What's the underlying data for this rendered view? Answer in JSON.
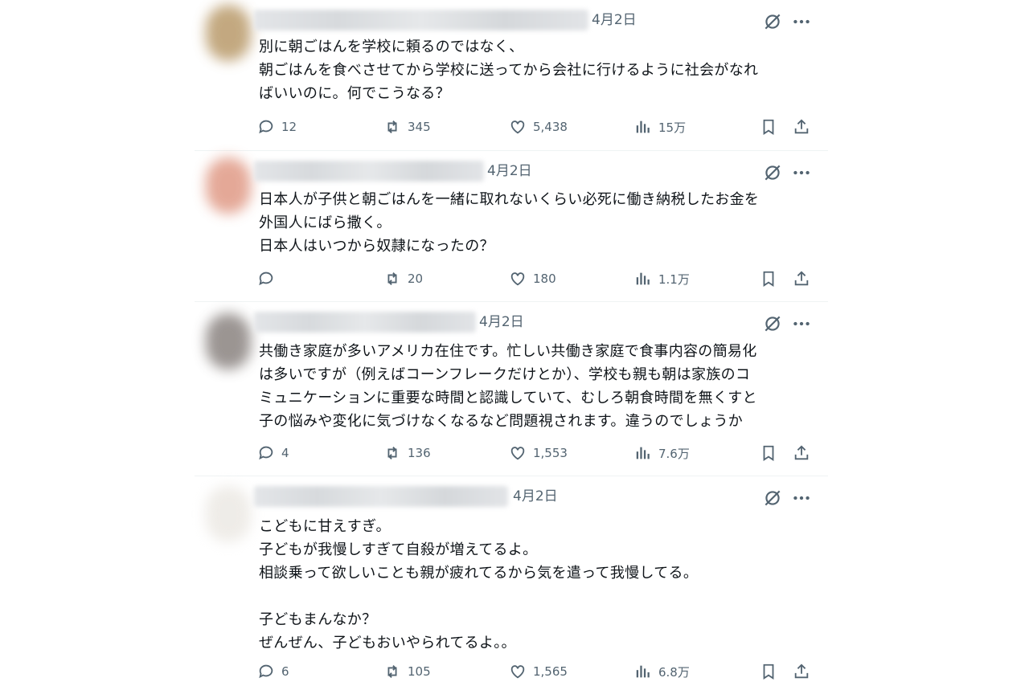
{
  "posts": [
    {
      "date": "4月2日",
      "text": "別に朝ごはんを学校に頼るのではなく、\n朝ごはんを食べさせてから学校に送ってから会社に行けるように社会がなれ\nばいいのに。何でこうなる？",
      "replies": "12",
      "reposts": "345",
      "likes": "5,438",
      "views": "15万"
    },
    {
      "date": "4月2日",
      "text": "日本人が子供と朝ごはんを一緒に取れないくらい必死に働き納税したお金を\n外国人にばら撒く。\n日本人はいつから奴隷になったの？",
      "replies": "",
      "reposts": "20",
      "likes": "180",
      "views": "1.1万"
    },
    {
      "date": "4月2日",
      "text": "共働き家庭が多いアメリカ在住です。忙しい共働き家庭で食事内容の簡易化\nは多いですが（例えばコーンフレークだけとか）、学校も親も朝は家族のコ\nミュニケーションに重要な時間と認識していて、むしろ朝食時間を無くすと\n子の悩みや変化に気づけなくなるなど問題視されます。違うのでしょうか",
      "replies": "4",
      "reposts": "136",
      "likes": "1,553",
      "views": "7.6万"
    },
    {
      "date": "4月2日",
      "text": "こどもに甘えすぎ。\n子どもが我慢しすぎて自殺が増えてるよ。\n相談乗って欲しいことも親が疲れてるから気を遣って我慢してる。\n\n子どもまんなか？\nぜんぜん、子どもおいやられてるよ。。",
      "replies": "6",
      "reposts": "105",
      "likes": "1,565",
      "views": "6.8万"
    }
  ],
  "icons": {
    "reply": "reply-icon",
    "repost": "repost-icon",
    "like": "like-icon",
    "views": "views-icon",
    "bookmark": "bookmark-icon",
    "share": "share-icon",
    "grok": "grok-icon",
    "more": "more-icon"
  },
  "colors": {
    "text": "#0f1419",
    "muted": "#536471",
    "divider": "#eff3f4"
  }
}
